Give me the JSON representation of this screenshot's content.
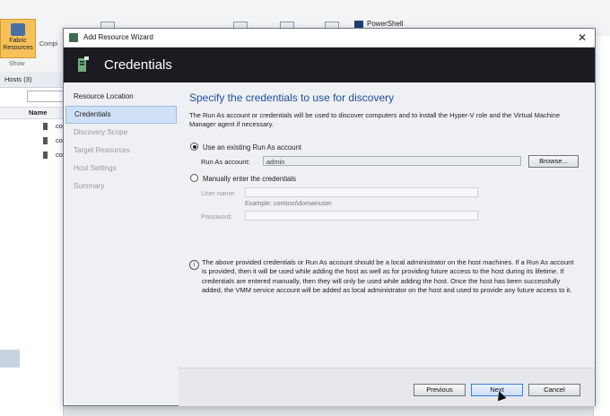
{
  "background": {
    "ribbon": {
      "fabric_resources_label": "Fabric Resources",
      "compute_label": "Compi",
      "show_label": "Show",
      "powershell_label": "PowerShell"
    },
    "hosts_pane": {
      "header": "Hosts (3)",
      "column_name": "Name",
      "rows": [
        "co",
        "co",
        "co"
      ]
    }
  },
  "wizard": {
    "title": "Add Resource Wizard",
    "close_glyph": "✕",
    "page_title": "Credentials",
    "nav_items": [
      {
        "label": "Resource Location",
        "state": "done"
      },
      {
        "label": "Credentials",
        "state": "active"
      },
      {
        "label": "Discovery Scope",
        "state": "pending"
      },
      {
        "label": "Target Resources",
        "state": "pending"
      },
      {
        "label": "Host Settings",
        "state": "pending"
      },
      {
        "label": "Summary",
        "state": "pending"
      }
    ],
    "heading": "Specify the credentials to use for discovery",
    "description": "The Run As account or credentials will be used to discover computers and to install the Hyper-V role and the Virtual Machine Manager agent if necessary.",
    "option_existing": {
      "label": "Use an existing Run As account",
      "selected": true
    },
    "run_as_label": "Run As account:",
    "run_as_value": "admin",
    "browse_label": "Browse...",
    "option_manual": {
      "label": "Manually enter the credentials",
      "selected": false
    },
    "username_label": "User name:",
    "username_value": "",
    "username_example": "Example: contoso\\domainuser",
    "password_label": "Password:",
    "password_value": "",
    "info_text": "The above provided credentials or Run As account should be a local administrator on the host machines. If a Run As account is provided, then it will be used while adding the host as well as for providing future access to the host during its lifetime. If credentials are entered manually, then they will only be used while adding the host. Once the host has been successfully added, the VMM service account will be added as local administrator on the host and used to provide any future access to it.",
    "buttons": {
      "previous": "Previous",
      "next": "Next",
      "cancel": "Cancel"
    }
  },
  "colors": {
    "heading": "#1f4e9a",
    "banner": "#1a1c22",
    "active_nav": "#cfe0f6",
    "fabric_button": "#f6c15a"
  },
  "icons": {
    "banner": "server-credentials-icon",
    "info": "info-icon",
    "close": "close-icon"
  }
}
